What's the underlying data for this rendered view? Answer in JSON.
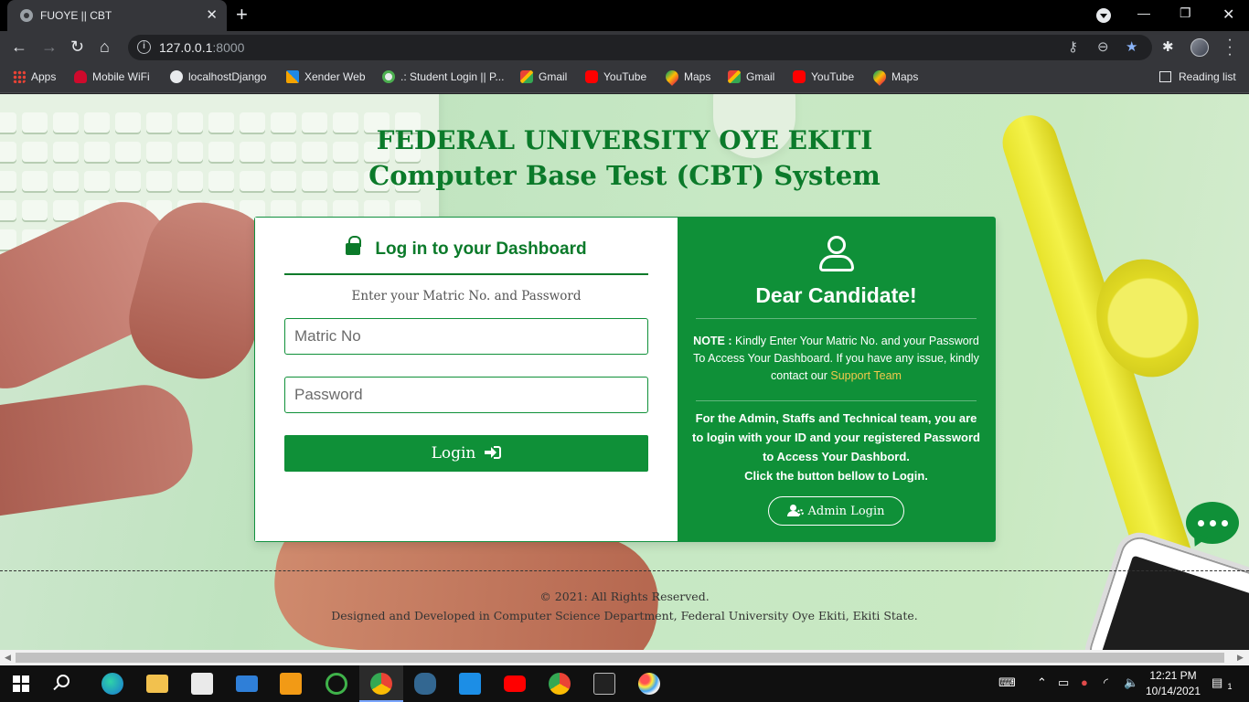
{
  "browser": {
    "tab_title": "FUOYE || CBT",
    "url_host": "127.0.0.1",
    "url_port": ":8000",
    "bookmarks": [
      {
        "label": "Apps",
        "icon": "apps-grid-icon"
      },
      {
        "label": "Mobile WiFi",
        "icon": "huawei-icon"
      },
      {
        "label": "localhostDjango",
        "icon": "globe-icon"
      },
      {
        "label": "Xender Web",
        "icon": "xender-icon"
      },
      {
        "label": ".: Student Login || P...",
        "icon": "student-portal-icon"
      },
      {
        "label": "Gmail",
        "icon": "gmail-icon"
      },
      {
        "label": "YouTube",
        "icon": "youtube-icon"
      },
      {
        "label": "Maps",
        "icon": "maps-icon"
      },
      {
        "label": "Gmail",
        "icon": "gmail-icon"
      },
      {
        "label": "YouTube",
        "icon": "youtube-icon"
      },
      {
        "label": "Maps",
        "icon": "maps-icon"
      }
    ],
    "reading_list": "Reading list"
  },
  "page": {
    "heading_line1": "FEDERAL UNIVERSITY OYE EKITI",
    "heading_line2": "Computer Base Test (CBT) System",
    "login": {
      "title": "Log in to your Dashboard",
      "subtitle": "Enter your Matric No. and Password",
      "matric_placeholder": "Matric No",
      "password_placeholder": "Password",
      "button_label": "Login"
    },
    "info": {
      "greeting": "Dear Candidate!",
      "note_label": "NOTE :",
      "note_text": " Kindly Enter Your Matric No. and your Password To Access Your Dashboard. If you have any issue, kindly contact our ",
      "support_link": "Support Team",
      "admin_note": "For the Admin, Staffs and Technical team, you are to login with your ID and your registered Password to Access Your Dashbord.",
      "admin_note_line2": "Click the button bellow to Login.",
      "admin_button": "Admin Login"
    },
    "footer_line1": "© 2021: All Rights Reserved.",
    "footer_line2": "Designed and Developed in Computer Science Department, Federal University Oye Ekiti, Ekiti State."
  },
  "taskbar": {
    "time": "12:21 PM",
    "date": "10/14/2021",
    "notification_count": "1"
  },
  "colors": {
    "brand_green": "#0f9038",
    "heading_green": "#0b7a2a",
    "support_link": "#f2c94c"
  }
}
